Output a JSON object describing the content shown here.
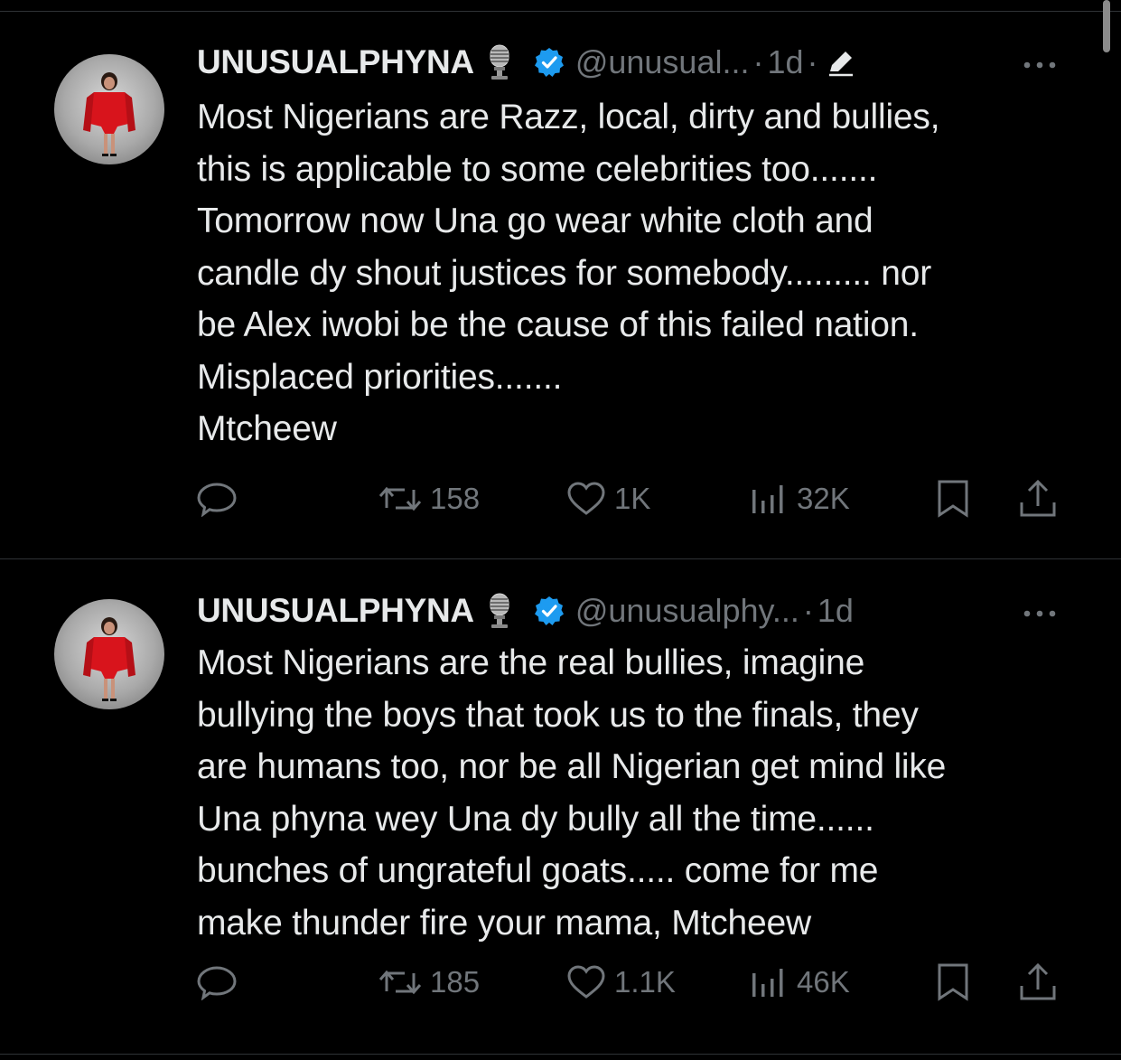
{
  "colors": {
    "background": "#000000",
    "text_primary": "#e7e9ea",
    "text_secondary": "#71767b",
    "verified": "#1d9bf0",
    "divider": "#2f3336"
  },
  "tweets": [
    {
      "display_name": "UNUSUALPHYNA",
      "handle": "@unusual...",
      "separator": "·",
      "time": "1d",
      "time_separator": "·",
      "edited": true,
      "text": "Most Nigerians are Razz, local, dirty and bullies,\nthis is applicable to some celebrities too.......\nTomorrow now Una go wear white cloth and\ncandle dy shout justices for somebody......... nor\nbe Alex iwobi be the cause of this failed nation.\nMisplaced priorities.......\nMtcheew",
      "actions": {
        "retweets": "158",
        "likes": "1K",
        "views": "32K"
      },
      "icons": [
        "microphone-emoji-icon",
        "verified-badge-icon",
        "edit-pencil-icon",
        "more-icon",
        "reply-icon",
        "retweet-icon",
        "like-icon",
        "views-icon",
        "bookmark-icon",
        "share-icon"
      ]
    },
    {
      "display_name": "UNUSUALPHYNA",
      "handle": "@unusualphy...",
      "separator": "·",
      "time": "1d",
      "text": "Most Nigerians are the real bullies, imagine\nbullying the boys that took us to the finals, they\nare humans too, nor be all Nigerian get mind like\nUna phyna wey Una dy bully all the time......\nbunches of ungrateful goats..... come for me\nmake thunder fire your mama, Mtcheew",
      "actions": {
        "retweets": "185",
        "likes": "1.1K",
        "views": "46K"
      },
      "icons": [
        "microphone-emoji-icon",
        "verified-badge-icon",
        "more-icon",
        "reply-icon",
        "retweet-icon",
        "like-icon",
        "views-icon",
        "bookmark-icon",
        "share-icon"
      ]
    }
  ]
}
